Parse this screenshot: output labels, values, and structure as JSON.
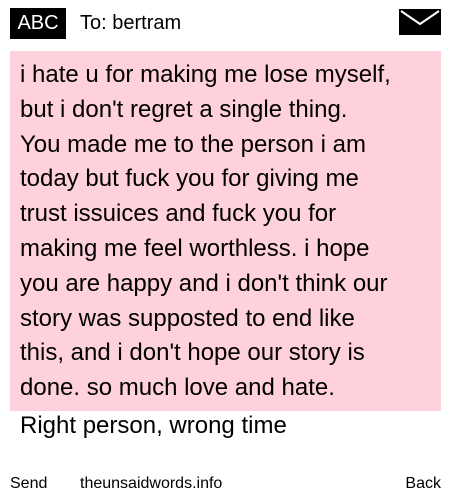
{
  "header": {
    "badge_label": "ABC",
    "recipient": "To: bertram",
    "icon": "envelope-icon"
  },
  "message": {
    "lines": [
      "i hate u for making me lose myself,",
      "but i don't regret a single thing.",
      "You made me to the person i am",
      "today but fuck you for giving me",
      "trust issuices and fuck you for",
      "making me feel worthless. i hope",
      "you are happy and i don't think our",
      "story was supposted to end like",
      "this, and i don't hope our story is",
      "done. so much love and hate."
    ],
    "signoff": "Right person, wrong time"
  },
  "footer": {
    "send_label": "Send",
    "site_label": "theunsaidwords.info",
    "back_label": "Back"
  },
  "colors": {
    "message_background": "#ffd1dc",
    "badge_background": "#000000",
    "text": "#000000"
  }
}
